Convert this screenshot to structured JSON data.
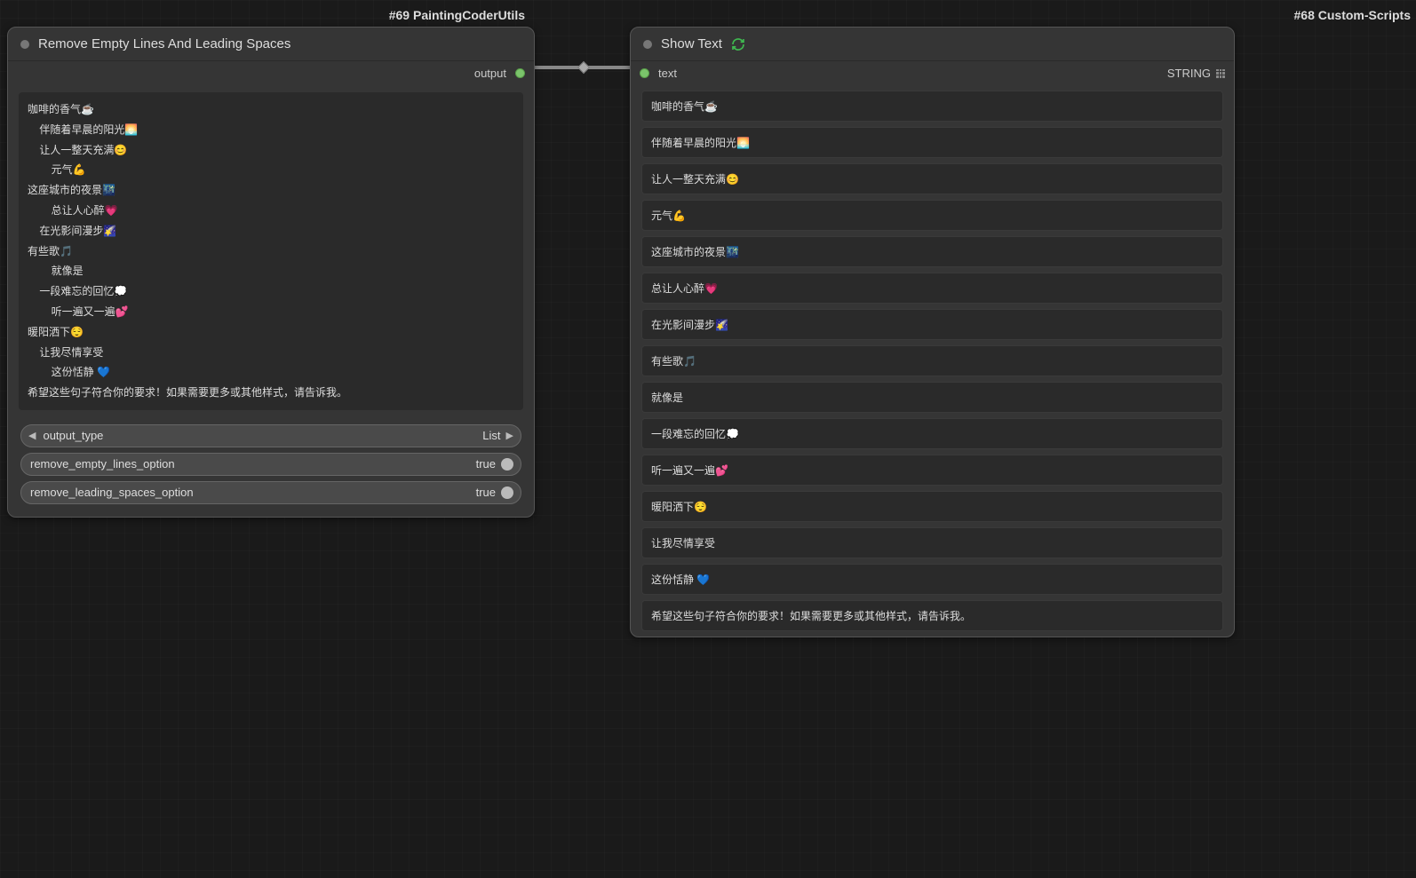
{
  "left": {
    "tag": "#69 PaintingCoderUtils",
    "title": "Remove Empty Lines And Leading Spaces",
    "outputPort": "output",
    "textContent": "咖啡的香气☕\n    伴随着早晨的阳光🌅\n    让人一整天充满😊\n        元气💪\n这座城市的夜景🌃\n        总让人心醉💗\n    在光影间漫步🌠\n有些歌🎵\n        就像是\n    一段难忘的回忆💭\n        听一遍又一遍💕\n暖阳洒下😌\n    让我尽情享受\n        这份恬静 💙\n希望这些句子符合你的要求！如果需要更多或其他样式，请告诉我。",
    "controls": {
      "outputType": {
        "label": "output_type",
        "value": "List"
      },
      "removeEmpty": {
        "label": "remove_empty_lines_option",
        "value": "true"
      },
      "removeLeading": {
        "label": "remove_leading_spaces_option",
        "value": "true"
      }
    }
  },
  "right": {
    "tag": "#68 Custom-Scripts",
    "title": "Show Text",
    "inputPort": "text",
    "outputPort": "STRING",
    "lines": [
      "咖啡的香气☕",
      "伴随着早晨的阳光🌅",
      "让人一整天充满😊",
      "元气💪",
      "这座城市的夜景🌃",
      "总让人心醉💗",
      "在光影间漫步🌠",
      "有些歌🎵",
      "就像是",
      "一段难忘的回忆💭",
      "听一遍又一遍💕",
      "暖阳洒下😌",
      "让我尽情享受",
      "这份恬静 💙",
      "希望这些句子符合你的要求！如果需要更多或其他样式，请告诉我。"
    ]
  }
}
